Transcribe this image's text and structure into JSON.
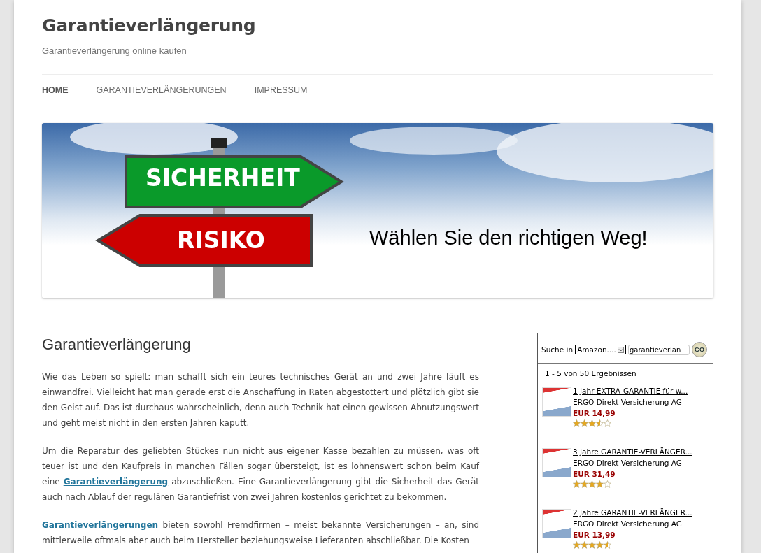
{
  "site": {
    "title": "Garantieverlängerung",
    "tagline": "Garantieverlängerung online kaufen"
  },
  "nav": [
    {
      "label": "HOME",
      "selected": true
    },
    {
      "label": "GARANTIEVERLÄNGERUNGEN",
      "selected": false
    },
    {
      "label": "IMPRESSUM",
      "selected": false
    }
  ],
  "banner": {
    "sign_top": "SICHERHEIT",
    "sign_bottom": "RISIKO",
    "slogan": "Wählen Sie den richtigen Weg!"
  },
  "article": {
    "heading": "Garantieverlängerung",
    "paragraphs": [
      {
        "parts": [
          {
            "kind": "text",
            "text": "Wie das Leben so spielt: man schafft sich ein teures technisches Gerät an und zwei Jahre läuft es einwandfrei. Vielleicht hat man gerade erst die Anschaffung in Raten abgestottert und plötzlich gibt sie den Geist auf. Das ist durchaus wahrscheinlich, denn auch Technik hat einen gewissen Abnutzungswert und geht meist nicht in den ersten Jahren kaputt."
          }
        ]
      },
      {
        "parts": [
          {
            "kind": "text",
            "text": "Um die Reparatur des geliebten Stückes nun nicht aus eigener Kasse bezahlen zu müssen, was oft teuer ist und den Kaufpreis in manchen Fällen sogar übersteigt, ist es lohnenswert schon beim Kauf eine "
          },
          {
            "kind": "link",
            "text": "Garantieverlängerung"
          },
          {
            "kind": "text",
            "text": " abzuschließen. Eine Garantieverlängerung gibt die Sicherheit das Gerät auch nach Ablauf der regulären Garantiefrist von zwei Jahren kostenlos gerichtet zu bekommen."
          }
        ]
      },
      {
        "parts": [
          {
            "kind": "link",
            "text": "Garantieverlängerungen"
          },
          {
            "kind": "text",
            "text": " bieten sowohl Fremdfirmen – meist bekannte Versicherungen – an, sind mittlerweile oftmals aber auch beim Hersteller beziehungsweise Lieferanten abschließbar. Die Kosten"
          }
        ]
      }
    ]
  },
  "widget": {
    "search_label": "Suche in",
    "store": "Amazon....",
    "query": "garantieverlän",
    "go": "GO",
    "results": "1 - 5 von 50 Ergebnissen",
    "products": [
      {
        "title": "1 Jahr EXTRA-GARANTIE für w...",
        "seller": "ERGO Direkt Versicherung AG",
        "price": "EUR 14,99",
        "stars": 3.5
      },
      {
        "title": "3 Jahre GARANTIE-VERLÄNGER...",
        "seller": "ERGO Direkt Versicherung AG",
        "price": "EUR 31,49",
        "stars": 4
      },
      {
        "title": "2 Jahre GARANTIE-VERLÄNGER...",
        "seller": "ERGO Direkt Versicherung AG",
        "price": "EUR 13,99",
        "stars": 4.5
      }
    ]
  }
}
